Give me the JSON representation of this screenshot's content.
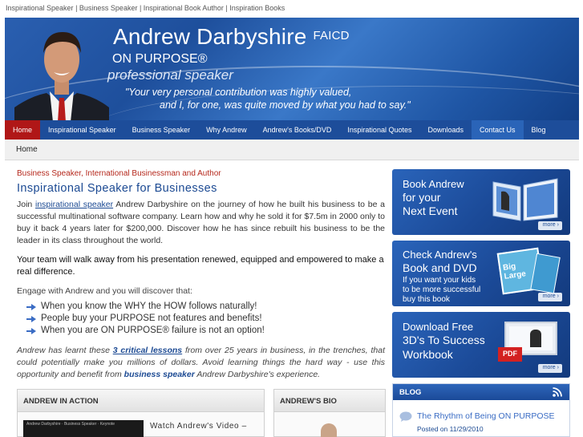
{
  "topline": {
    "items": [
      "Inspirational Speaker",
      "Business Speaker",
      "Inspirational Book Author",
      "Inspiration Books"
    ],
    "separator": " | "
  },
  "banner": {
    "name": "Andrew Darbyshire",
    "credential": "FAICD",
    "purpose": "ON PURPOSE®",
    "role": "professional speaker",
    "quote_line1": "\"Your very personal contribution was highly valued,",
    "quote_line2": "and I, for one, was quite moved by what you had to say.\""
  },
  "nav": {
    "items": [
      {
        "label": "Home"
      },
      {
        "label": "Inspirational Speaker"
      },
      {
        "label": "Business Speaker"
      },
      {
        "label": "Why Andrew"
      },
      {
        "label": "Andrew's Books/DVD"
      },
      {
        "label": "Inspirational Quotes"
      },
      {
        "label": "Downloads"
      },
      {
        "label": "Contact Us"
      },
      {
        "label": "Blog"
      }
    ]
  },
  "breadcrumb": "Home",
  "main": {
    "tagline": "Business Speaker, International Businessman and Author",
    "heading": "Inspirational Speaker for Businesses",
    "p1_pre": "Join ",
    "p1_link": "inspirational speaker",
    "p1_post": " Andrew Darbyshire on the journey of how he built his business to be a successful multinational software company. Learn how and why he sold it for $7.5m in 2000 only to buy it back 4 years later for $200,000. Discover how he has since rebuilt his business to be the leader in its class throughout the world.",
    "p2": "Your team will walk away from his presentation renewed, equipped and empowered to make a real difference.",
    "p3": "Engage with Andrew and you will discover that:",
    "bullets": [
      "When you know the WHY the HOW follows naturally!",
      "People buy your PURPOSE not features and benefits!",
      "When you are ON PURPOSE® failure is not an option!"
    ],
    "p4_a": "Andrew has learnt these ",
    "p4_b": "3 critical lessons",
    "p4_c": " from over 25 years in business, in the trenches, that could potentially make you millions of dollars. Avoid learning things the hard way - use this opportunity and benefit from ",
    "p4_d": "business speaker",
    "p4_e": " Andrew Darbyshire's experience."
  },
  "action_box": {
    "title": "ANDREW IN ACTION",
    "video_caption": "Andrew Darbyshire · Business Speaker · Keynote",
    "watch_text": "Watch Andrew's Video –"
  },
  "bio_box": {
    "title": "ANDREW'S BIO"
  },
  "promos": [
    {
      "line1": "Book Andrew",
      "line2": "for your",
      "line3": "Next Event",
      "more": "more"
    },
    {
      "line1": "Check Andrew's",
      "line2": "Book and DVD",
      "sub1": "If you want your kids",
      "sub2": "to be more successful",
      "sub3": "buy this book",
      "book_text": "Big Large",
      "more": "more"
    },
    {
      "line1": "Download Free",
      "line2": "3D's To Success",
      "line3": "Workbook",
      "pdf": "PDF",
      "more": "more"
    }
  ],
  "blog": {
    "title": "BLOG",
    "post_title": "The Rhythm of Being ON PURPOSE",
    "posted_on": "Posted on",
    "date": "11/29/2010"
  },
  "colors": {
    "nav_bg": "#1d4d9a",
    "nav_active": "#b01717",
    "heading": "#1c4a93",
    "tagline": "#b5281c"
  }
}
